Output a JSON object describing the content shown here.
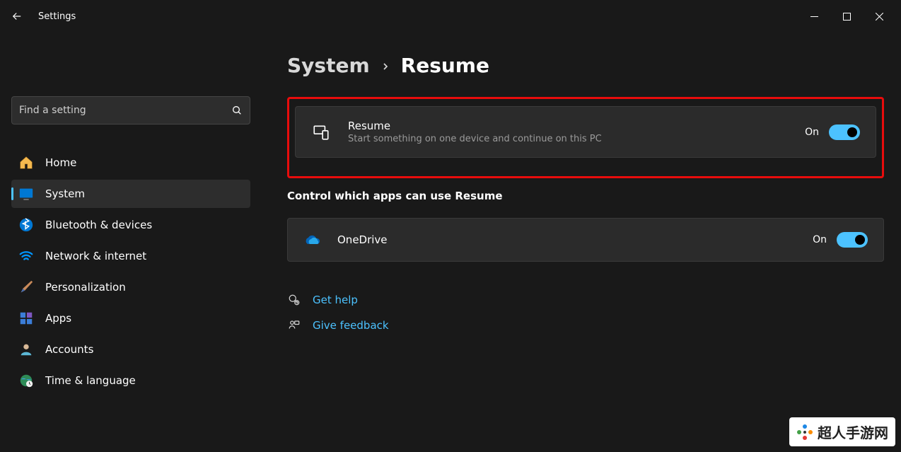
{
  "window": {
    "title": "Settings"
  },
  "search": {
    "placeholder": "Find a setting"
  },
  "sidebar": {
    "items": [
      {
        "label": "Home"
      },
      {
        "label": "System"
      },
      {
        "label": "Bluetooth & devices"
      },
      {
        "label": "Network & internet"
      },
      {
        "label": "Personalization"
      },
      {
        "label": "Apps"
      },
      {
        "label": "Accounts"
      },
      {
        "label": "Time & language"
      }
    ]
  },
  "breadcrumb": {
    "parent": "System",
    "current": "Resume"
  },
  "resume_card": {
    "title": "Resume",
    "description": "Start something on one device and continue on this PC",
    "toggle_value": "On"
  },
  "apps_section": {
    "heading": "Control which apps can use Resume",
    "items": [
      {
        "name": "OneDrive",
        "toggle_value": "On"
      }
    ]
  },
  "help": {
    "get_help": "Get help",
    "give_feedback": "Give feedback"
  },
  "watermark": "超人手游网"
}
